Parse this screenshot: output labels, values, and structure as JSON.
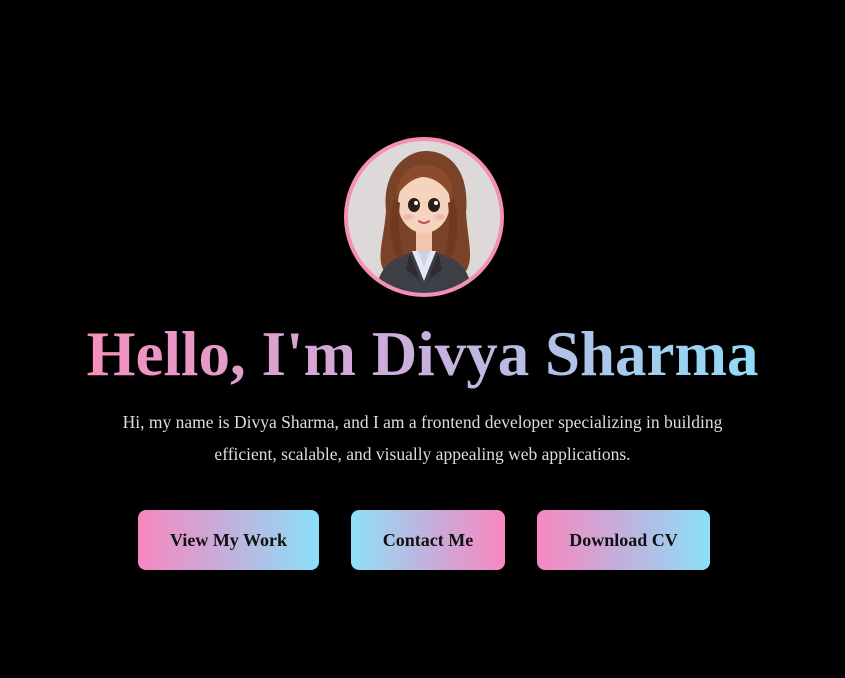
{
  "hero": {
    "avatar_alt": "Cartoon portrait of Divya Sharma",
    "title": "Hello, I'm Divya Sharma",
    "intro": "Hi, my name is Divya Sharma, and I am a frontend developer specializing in building efficient, scalable, and visually appealing web applications.",
    "buttons": {
      "view_work": "View My Work",
      "contact": "Contact Me",
      "download_cv": "Download CV"
    }
  },
  "colors": {
    "background": "#000000",
    "accent_pink": "#f48fbd",
    "accent_blue": "#8fdcf7",
    "avatar_border": "#f48fb6",
    "text": "#dddddd"
  },
  "icons": [
    "avatar-illustration"
  ]
}
